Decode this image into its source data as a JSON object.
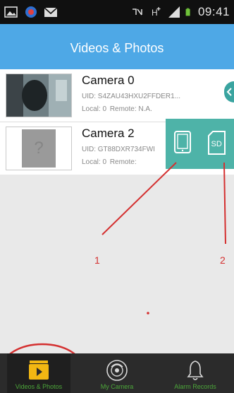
{
  "status_bar": {
    "time": "09:41",
    "left_icons": [
      "image-icon",
      "camera-app-icon",
      "mail-icon"
    ],
    "right_icons": [
      "nfc-icon",
      "hplus-icon",
      "signal-icon",
      "battery-icon"
    ]
  },
  "header": {
    "title": "Videos & Photos"
  },
  "cameras": [
    {
      "name": "Camera 0",
      "uid": "UID: S4ZAU43HXU2FFDER1...",
      "local": "Local: 0",
      "remote": "Remote: N.A."
    },
    {
      "name": "Camera 2",
      "uid": "UID: GT88DXR734FWI",
      "local": "Local: 0",
      "remote": "Remote:",
      "thumb_placeholder": "?"
    }
  ],
  "action_panel": {
    "device_icon": "tablet-icon",
    "sd_label": "SD"
  },
  "annotations": {
    "label_1": "1",
    "label_2": "2"
  },
  "colors": {
    "header": "#4ea8e6",
    "panel": "#4eb3a8",
    "nav_label": "#4ca63a",
    "active_icon": "#f2b713",
    "annotation": "#d43030"
  },
  "bottom_nav": [
    {
      "label": "Videos & Photos",
      "icon": "play-folder-icon",
      "active": true
    },
    {
      "label": "My Camera",
      "icon": "camera-lens-icon",
      "active": false
    },
    {
      "label": "Alarm Records",
      "icon": "bell-icon",
      "active": false
    }
  ]
}
